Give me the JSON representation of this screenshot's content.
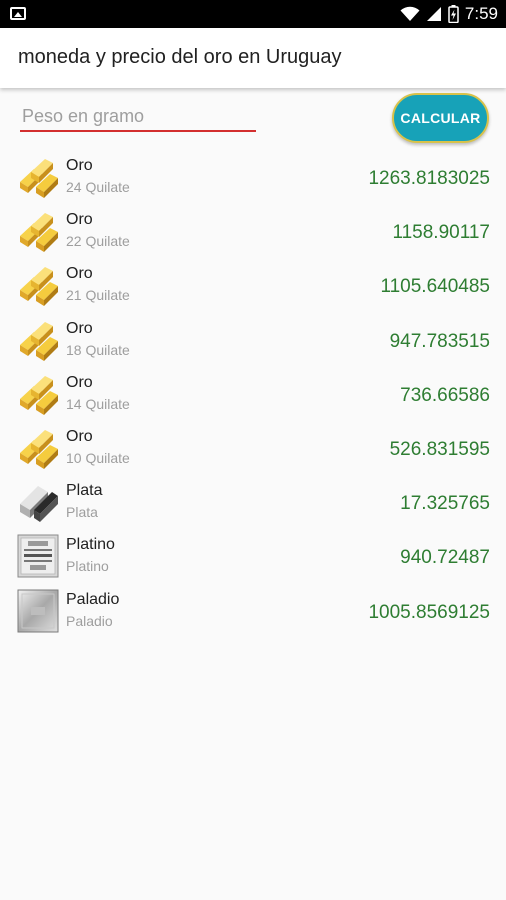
{
  "status_bar": {
    "time": "7:59",
    "icons": [
      "image-notification-icon",
      "wifi-icon",
      "cellular-signal-icon",
      "battery-charging-icon"
    ]
  },
  "app_bar": {
    "title": "moneda y precio del oro en Uruguay"
  },
  "form": {
    "weight_placeholder": "Peso en gramo",
    "weight_value": "",
    "calculate_label": "CALCULAR"
  },
  "colors": {
    "accent_underline": "#d32f2f",
    "button_bg": "#17a2b8",
    "button_border": "#d8c24a",
    "price_text": "#2e7d32"
  },
  "metals": [
    {
      "name": "Oro",
      "subtitle": "24 Quilate",
      "price": "1263.8183025",
      "icon": "gold-bars-icon"
    },
    {
      "name": "Oro",
      "subtitle": "22 Quilate",
      "price": "1158.90117",
      "icon": "gold-bars-icon"
    },
    {
      "name": "Oro",
      "subtitle": "21 Quilate",
      "price": "1105.640485",
      "icon": "gold-bars-icon"
    },
    {
      "name": "Oro",
      "subtitle": "18 Quilate",
      "price": "947.783515",
      "icon": "gold-bars-icon"
    },
    {
      "name": "Oro",
      "subtitle": "14 Quilate",
      "price": "736.66586",
      "icon": "gold-bars-icon"
    },
    {
      "name": "Oro",
      "subtitle": "10 Quilate",
      "price": "526.831595",
      "icon": "gold-bars-icon"
    },
    {
      "name": "Plata",
      "subtitle": "Plata",
      "price": "17.325765",
      "icon": "silver-bar-icon"
    },
    {
      "name": "Platino",
      "subtitle": "Platino",
      "price": "940.72487",
      "icon": "platinum-bar-icon"
    },
    {
      "name": "Paladio",
      "subtitle": "Paladio",
      "price": "1005.8569125",
      "icon": "palladium-bar-icon"
    }
  ]
}
